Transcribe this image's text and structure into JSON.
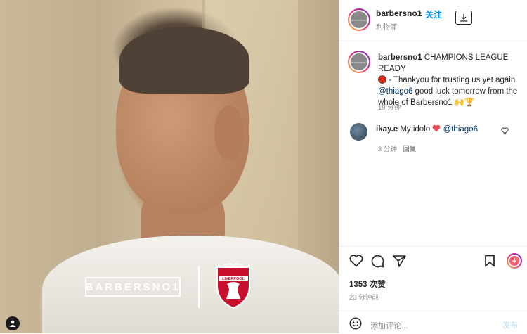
{
  "media": {
    "brand_text": "BARBERSNO1",
    "crest_text": "LIVERPOOL"
  },
  "header": {
    "username": "barbersno1",
    "dot": "•",
    "follow_label": "关注",
    "subtitle": "利物浦",
    "avatar_text": "barbersno1"
  },
  "caption": {
    "username": "barbersno1",
    "text_1": "CHAMPIONS LEAGUE READY",
    "text_2": " - Thankyou for trusting us yet again",
    "mention": "@thiago6",
    "text_3": " good luck tomorrow from the whole of Barbersno1 ",
    "emoji": "🙌🏆",
    "time": "19 分钟"
  },
  "comment": {
    "username": "ikay.e",
    "text": "My idolo",
    "mention": "@thiago6",
    "time": "3 分钟",
    "reply_label": "回复"
  },
  "stats": {
    "likes": "1353 次赞",
    "posted": "23 分钟前"
  },
  "add_comment": {
    "placeholder": "添加评论...",
    "post_label": "发布"
  },
  "colors": {
    "accent": "#0095f6",
    "text": "#262626",
    "muted": "#8e8e8e",
    "heart": "#ed4956",
    "lfc_red": "#c8102e"
  }
}
